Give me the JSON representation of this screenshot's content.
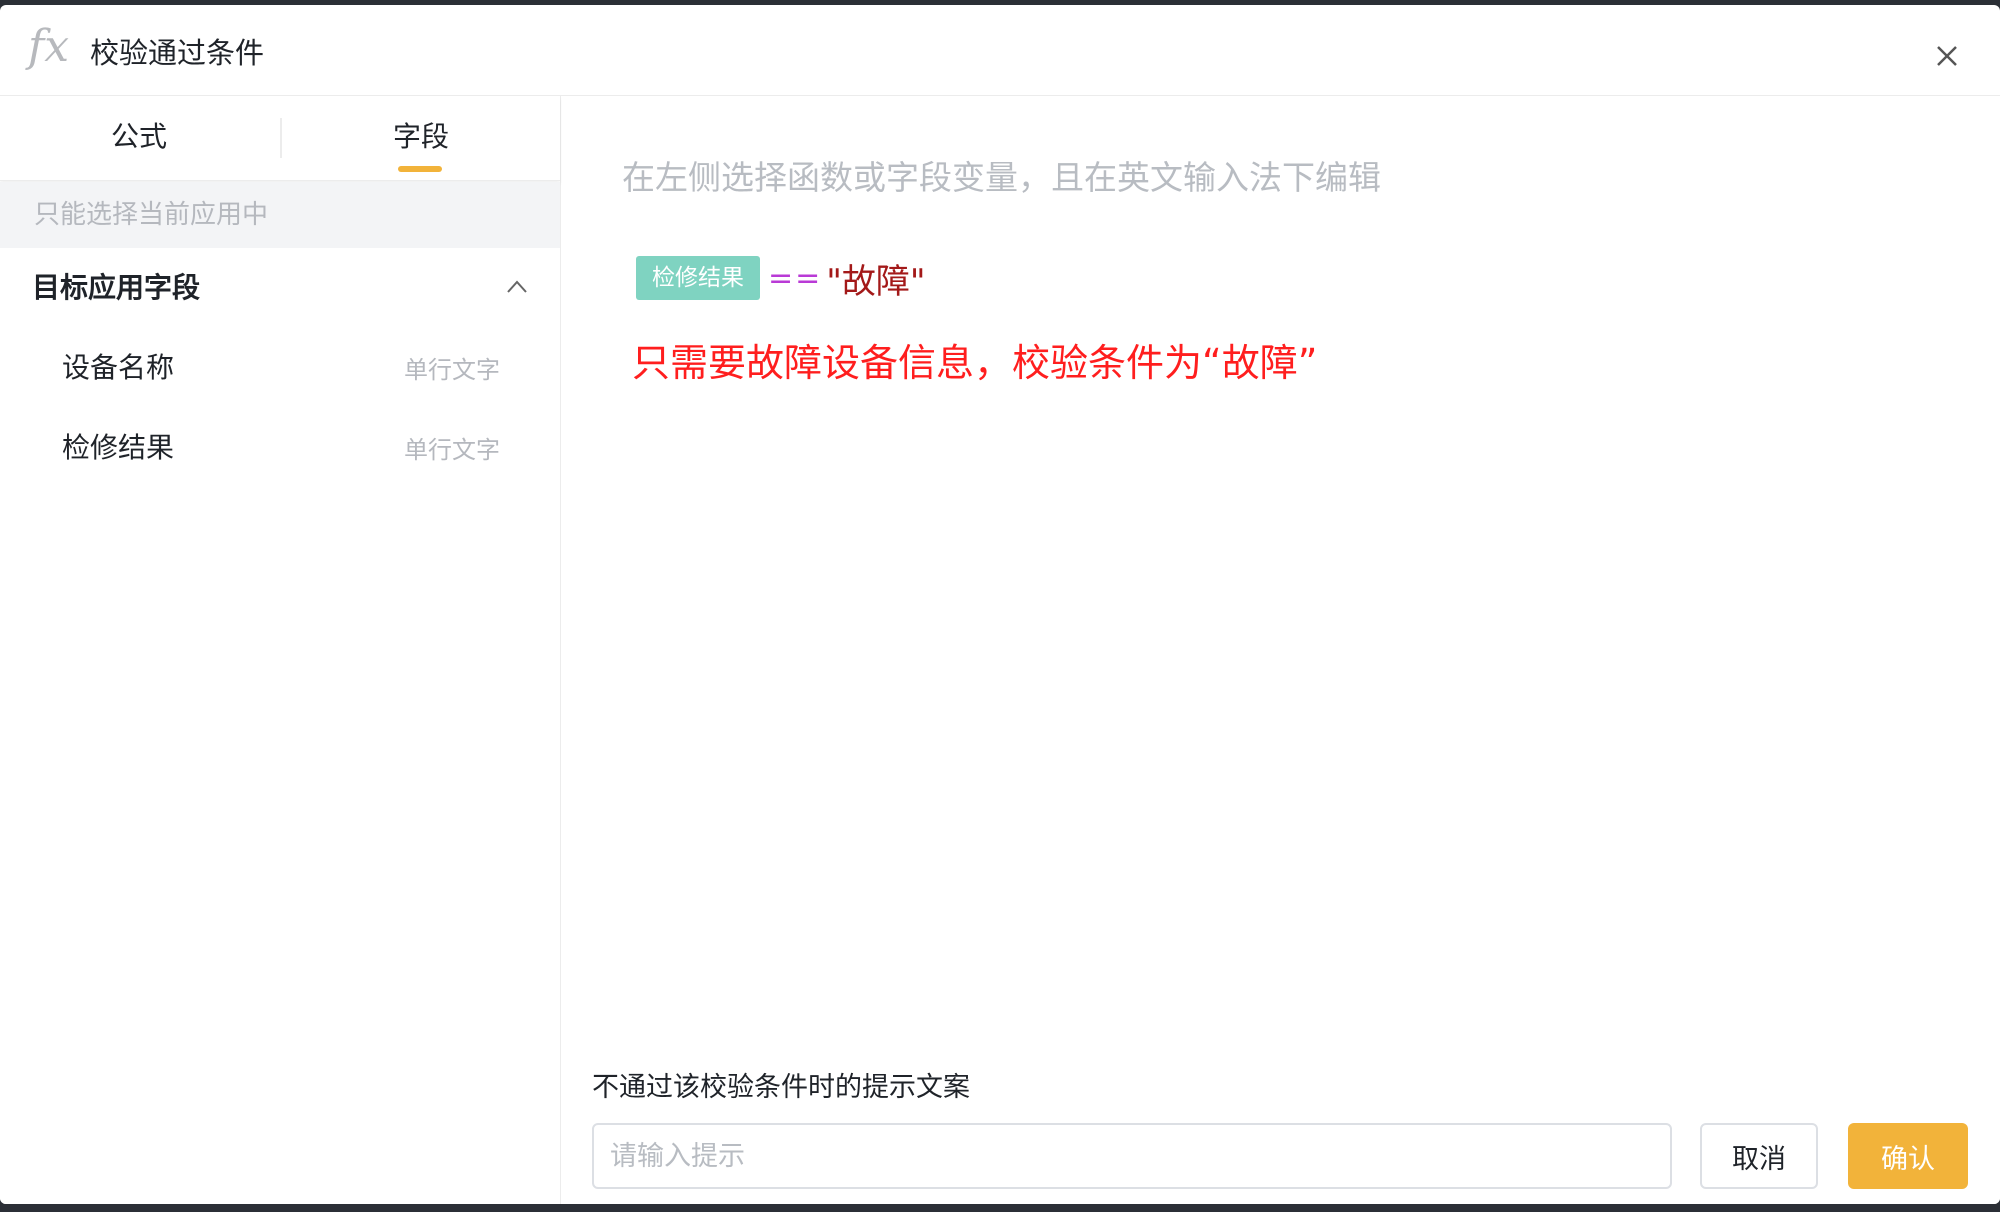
{
  "dialog": {
    "icon": "fx-icon",
    "title": "校验通过条件",
    "close_icon": "close-icon"
  },
  "left_panel": {
    "tabs": [
      {
        "label": "公式",
        "active": false
      },
      {
        "label": "字段",
        "active": true
      }
    ],
    "hint": "只能选择当前应用中",
    "group": {
      "title": "目标应用字段",
      "expanded": true,
      "items": [
        {
          "name": "设备名称",
          "type": "单行文字"
        },
        {
          "name": "检修结果",
          "type": "单行文字"
        }
      ]
    }
  },
  "editor": {
    "placeholder": "在左侧选择函数或字段变量，且在英文输入法下编辑",
    "formula": {
      "field_tag": "检修结果",
      "operator": "==",
      "value": "\"故障\""
    },
    "annotation": "只需要故障设备信息，校验条件为“故障”"
  },
  "footer": {
    "message_label": "不通过该校验条件时的提示文案",
    "message_placeholder": "请输入提示",
    "message_value": "",
    "cancel_label": "取消",
    "confirm_label": "确认"
  },
  "colors": {
    "accent": "#f2b33a",
    "field_tag_bg": "#7fd3c1",
    "operator": "#b93ad6",
    "string_literal": "#a31919",
    "annotation": "#ff1e1e"
  }
}
